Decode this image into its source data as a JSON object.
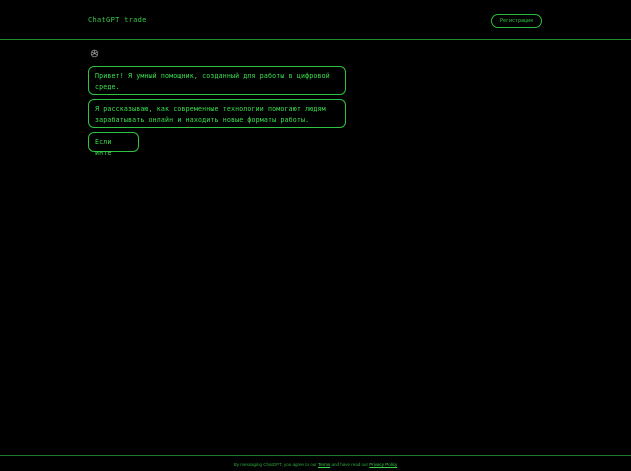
{
  "header": {
    "brand": "ChatGPT trade",
    "register_label": "Регистрация"
  },
  "chat": {
    "avatar_icon": "openai-logo-icon",
    "messages": [
      {
        "text": "Привет! Я умный помощник, созданный для работы в цифровой\nсреде."
      },
      {
        "text": "Я рассказываю, как современные технологии помогают людям\nзарабатывать онлайн и находить новые форматы работы."
      },
      {
        "text": "Если инте"
      }
    ]
  },
  "footer": {
    "prefix": "By messaging ChatGPT, you agree to our ",
    "terms": "Terms",
    "middle": " and have read our ",
    "privacy": "Privacy Policy"
  },
  "colors": {
    "background": "#000000",
    "accent": "#3bd14a",
    "border": "#2fc241"
  }
}
